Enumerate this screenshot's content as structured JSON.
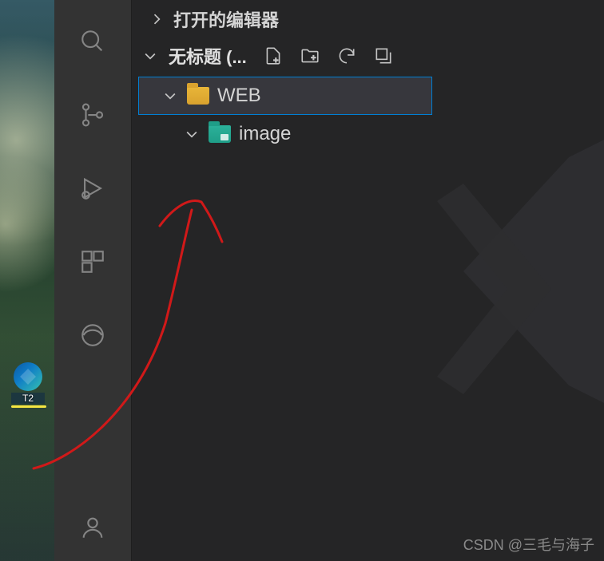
{
  "desktop": {
    "shortcut_label": "T2"
  },
  "explorer": {
    "open_editors_label": "打开的编辑器",
    "workspace_label": "无标题 (...",
    "tree": {
      "root": {
        "name": "WEB"
      },
      "child": {
        "name": "image"
      }
    }
  },
  "watermark": "CSDN @三毛与海子"
}
